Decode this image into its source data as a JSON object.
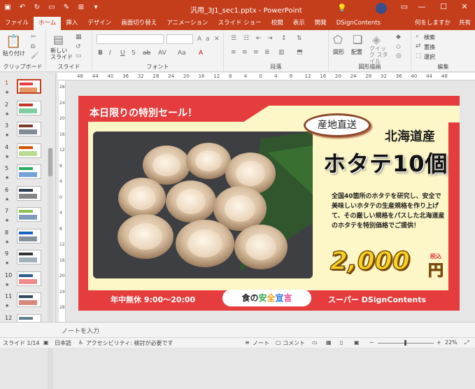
{
  "window": {
    "doc_title": "汎用_3J1_sec1.pptx - PowerPoint",
    "help_search": "何をしますか",
    "share": "共有"
  },
  "tabs": [
    "ファイル",
    "ホーム",
    "挿入",
    "デザイン",
    "画面切り替え",
    "アニメーション",
    "スライド ショー",
    "校閲",
    "表示",
    "開発",
    "DSignContents"
  ],
  "ribbon": {
    "groups": [
      "クリップボード",
      "スライド",
      "フォント",
      "段落",
      "図形描画",
      "編集"
    ],
    "paste_label": "貼り付け",
    "new_slide_label": "新しい スライド",
    "shape_label": "図形",
    "arrange_label": "配置",
    "quick_style_label": "クイック スタイル",
    "find_label": "検索",
    "replace_label": "置換",
    "select_label": "選択",
    "format_buttons": [
      "B",
      "I",
      "U",
      "S",
      "ab",
      "AV",
      "Aa",
      "A"
    ]
  },
  "ruler_numbers": [
    "48",
    "44",
    "40",
    "36",
    "32",
    "28",
    "24",
    "20",
    "16",
    "12",
    "8",
    "4",
    "0",
    "4",
    "8",
    "12",
    "16",
    "20",
    "24",
    "28",
    "32",
    "36",
    "40",
    "44",
    "48"
  ],
  "vruler_numbers": [
    "28",
    "24",
    "20",
    "16",
    "12",
    "8",
    "4",
    "0",
    "4",
    "8",
    "12",
    "16",
    "20",
    "24",
    "28"
  ],
  "thumbnails": [
    "1",
    "2",
    "3",
    "4",
    "5",
    "6",
    "7",
    "8",
    "9",
    "10",
    "11",
    "12"
  ],
  "slide": {
    "sale_title": "本日限りの特別セール！",
    "origin_badge": "産地直送",
    "region": "北海道産",
    "product": "ホタテ10個",
    "description": "全国40箇所のホタテを研究し、安全で美味しいホタテの生産規格を作り上げて、その厳しい規格をパスした北海道産のホタテを特別価格でご提供！",
    "price": "2,000",
    "tax_label": "税込",
    "yen": "円",
    "hours": "年中無休 9:00〜20:00",
    "safety_parts": [
      "食の",
      "安",
      "全",
      "宣",
      "言"
    ],
    "store": "スーパー DSignContents"
  },
  "notes_placeholder": "ノートを入力",
  "status": {
    "slide_count": "スライド 1/14",
    "language": "日本語",
    "accessibility": "アクセシビリティ: 検討が必要です",
    "notes": "ノート",
    "comments": "コメント",
    "zoom": "22%"
  },
  "colors": {
    "accent": "#c43e1c",
    "slide_red": "#e53d3d",
    "slide_cream": "#fdf6c6",
    "price_yellow": "#f6d320",
    "safety_green": "#2fa84f",
    "safety_orange": "#f39c12",
    "safety_blue": "#2f80ed",
    "safety_pink": "#e84393"
  }
}
